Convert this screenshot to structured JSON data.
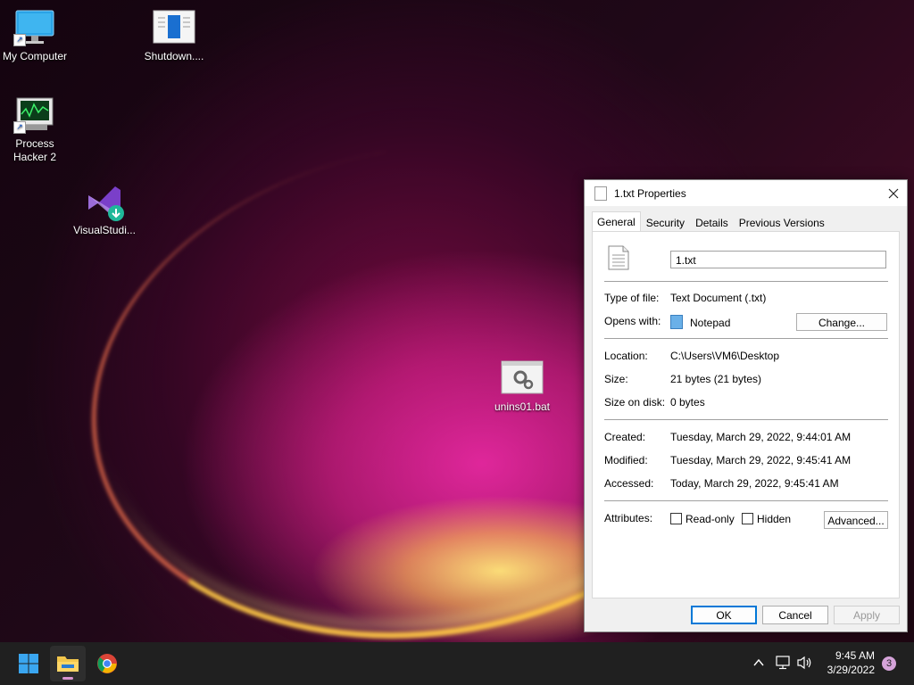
{
  "desktop": {
    "icons": [
      {
        "label": "My Computer"
      },
      {
        "label": "Shutdown...."
      },
      {
        "label": "Process Hacker 2"
      },
      {
        "label": "VisualStudi..."
      },
      {
        "label": "unins01.bat"
      }
    ]
  },
  "dialog": {
    "title": "1.txt Properties",
    "tabs": [
      {
        "label": "General",
        "active": true
      },
      {
        "label": "Security"
      },
      {
        "label": "Details"
      },
      {
        "label": "Previous Versions"
      }
    ],
    "file_name": "1.txt",
    "type_label": "Type of file:",
    "type_value": "Text Document (.txt)",
    "opens_label": "Opens with:",
    "opens_value": "Notepad",
    "change_label": "Change...",
    "location_label": "Location:",
    "location_value": "C:\\Users\\VM6\\Desktop",
    "size_label": "Size:",
    "size_value": "21 bytes (21 bytes)",
    "size_disk_label": "Size on disk:",
    "size_disk_value": "0 bytes",
    "created_label": "Created:",
    "created_value": "Tuesday, March 29, 2022, 9:44:01 AM",
    "modified_label": "Modified:",
    "modified_value": "Tuesday, March 29, 2022, 9:45:41 AM",
    "accessed_label": "Accessed:",
    "accessed_value": "Today, March 29, 2022, 9:45:41 AM",
    "attributes_label": "Attributes:",
    "readonly_label": "Read-only",
    "hidden_label": "Hidden",
    "advanced_label": "Advanced...",
    "ok_label": "OK",
    "cancel_label": "Cancel",
    "apply_label": "Apply"
  },
  "taskbar": {
    "time": "9:45 AM",
    "date": "3/29/2022",
    "notification_count": "3"
  },
  "colors": {
    "accent": "#0078d7",
    "taskbar": "#202020"
  }
}
